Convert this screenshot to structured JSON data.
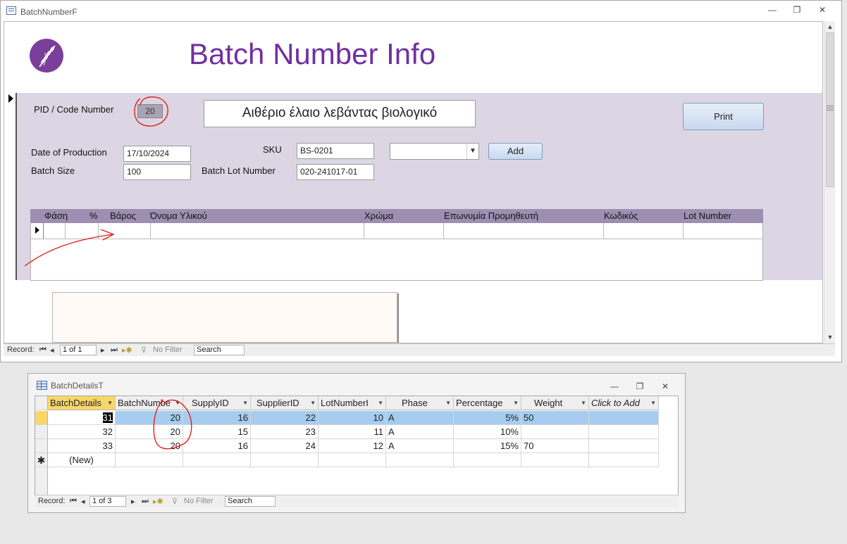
{
  "form_window": {
    "title": "BatchNumberF",
    "controls": {
      "minimize": "—",
      "restore": "❐",
      "close": "✕"
    }
  },
  "form": {
    "title": "Batch Number Info",
    "pid_label": "PID / Code Number",
    "pid_value": "20",
    "product_name": "Αιθέριο έλαιο λεβάντας βιολογικό",
    "print_button": "Print",
    "date_label": "Date of Production",
    "date_value": "17/10/2024",
    "batch_size_label": "Batch Size",
    "batch_size_value": "100",
    "sku_label": "SKU",
    "sku_value": "BS-0201",
    "lot_label": "Batch Lot Number",
    "lot_value": "020-241017-01",
    "combo_value": "",
    "add_button": "Add",
    "subform_columns": [
      "Φάση",
      "%",
      "Βάρος",
      "Όνομα Υλικού",
      "Χρώμα",
      "Επωνυμία Προμηθευτή",
      "Κωδικός",
      "Lot Number"
    ]
  },
  "form_nav": {
    "record_label": "Record:",
    "position": "1 of 1",
    "filter": "No Filter",
    "search": "Search"
  },
  "table_window": {
    "title": "BatchDetailsT",
    "columns": [
      "BatchDetails",
      "BatchNumbe",
      "SupplyID",
      "SupplierID",
      "LotNumberI",
      "Phase",
      "Percentage",
      "Weight",
      "Click to Add"
    ],
    "rows": [
      {
        "id": "31",
        "batch": "20",
        "supply": "16",
        "supplier": "22",
        "lotnum": "10",
        "phase": "A",
        "percent": "5%",
        "weight": "50"
      },
      {
        "id": "32",
        "batch": "20",
        "supply": "15",
        "supplier": "23",
        "lotnum": "11",
        "phase": "A",
        "percent": "10%",
        "weight": ""
      },
      {
        "id": "33",
        "batch": "20",
        "supply": "16",
        "supplier": "24",
        "lotnum": "12",
        "phase": "A",
        "percent": "15%",
        "weight": "70"
      }
    ],
    "new_row": "(New)"
  },
  "table_nav": {
    "record_label": "Record:",
    "position": "1 of 3",
    "filter": "No Filter",
    "search": "Search"
  },
  "colors": {
    "title_purple": "#7030a0",
    "form_band": "#dcd6e4",
    "subform_header": "#9e8fb2",
    "selected_row": "#a6cdf0",
    "annotation_red": "#e0201b"
  }
}
